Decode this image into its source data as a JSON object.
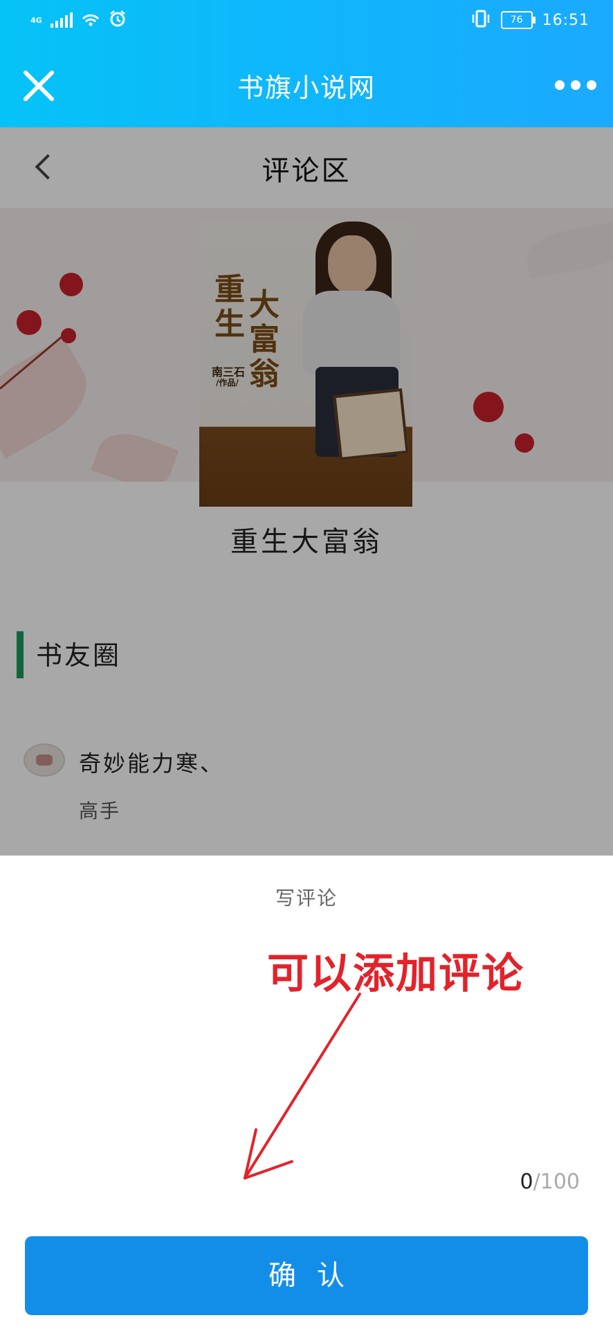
{
  "status_bar": {
    "network": "4G",
    "battery": "76",
    "time": "16:51"
  },
  "app_bar": {
    "title": "书旗小说网"
  },
  "page": {
    "title": "评论区",
    "book_name": "重生大富翁",
    "cover": {
      "title_line1": "重生",
      "title_line2": "大富翁",
      "author": "南三石",
      "author_note": "/作品/"
    },
    "circle": {
      "title": "书友圈",
      "user": {
        "name": "奇妙能力寒、",
        "level": "高手"
      }
    }
  },
  "sheet": {
    "title": "写评论",
    "annotation": "可以添加评论",
    "counter": {
      "current": "0",
      "separator": "/",
      "max": "100"
    },
    "confirm_label": "确认"
  },
  "colors": {
    "app_bar": "#1ba9ff",
    "confirm_button": "#138ee8",
    "annotation": "#e2232a",
    "section_accent": "#1a9a5a"
  }
}
